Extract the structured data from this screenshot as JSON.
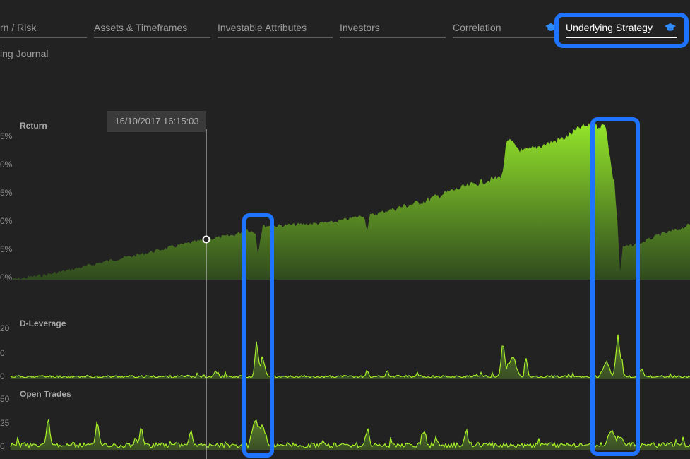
{
  "tabs": [
    {
      "label": "rn / Risk",
      "active": false
    },
    {
      "label": "Assets & Timeframes",
      "active": false
    },
    {
      "label": "Investable Attributes",
      "active": false
    },
    {
      "label": "Investors",
      "active": false
    },
    {
      "label": "Correlation",
      "active": false
    },
    {
      "label": "Underlying Strategy",
      "active": true
    }
  ],
  "subnav": {
    "label": "ing Journal"
  },
  "tooltip": {
    "text": "16/10/2017 16:15:03"
  },
  "panels": {
    "return": {
      "title": "Return",
      "tick_labels": [
        "5%",
        "0%",
        "5%",
        "0%",
        "5%",
        "0%"
      ]
    },
    "leverage": {
      "title": "D-Leverage",
      "tick_labels": [
        "20",
        "0",
        "0"
      ]
    },
    "trades": {
      "title": "Open Trades",
      "tick_labels": [
        "50",
        "25",
        "0"
      ]
    }
  },
  "colors": {
    "background": "#222222",
    "series_line": "#a6f02a",
    "area_top": "#8fe028",
    "area_bottom": "#2f4a1e",
    "highlight": "#1f74ff",
    "cap_icon": "#2f8dff"
  }
}
